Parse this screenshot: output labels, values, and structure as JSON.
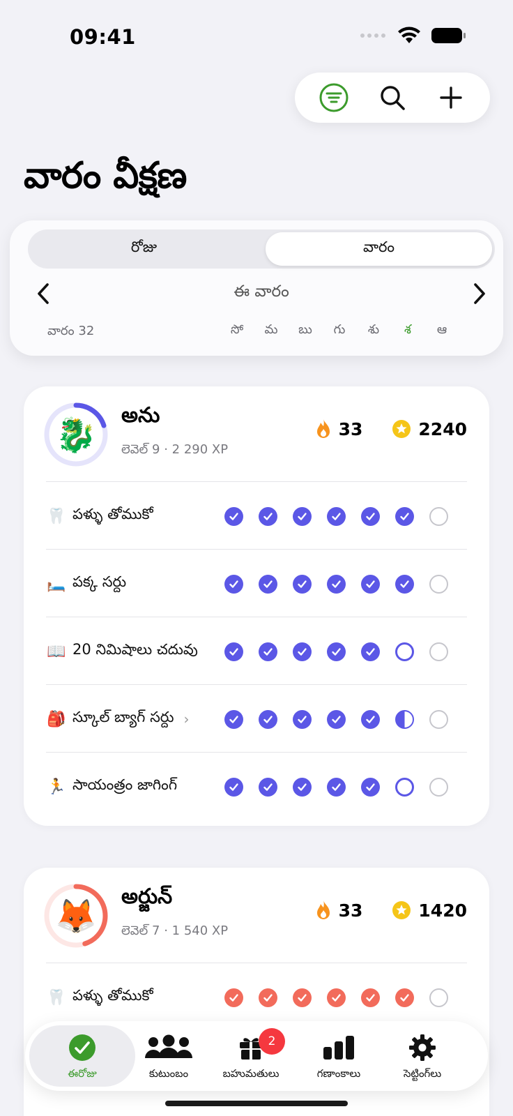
{
  "status": {
    "time": "09:41"
  },
  "title": "వారం వీక్షణ",
  "segment": {
    "day": "రోజు",
    "week": "వారం",
    "selected": "week"
  },
  "week_nav": {
    "label": "ఈ వారం",
    "week_number": "వారం 32"
  },
  "days": [
    "సో",
    "మ",
    "బు",
    "గు",
    "శు",
    "శ",
    "ఆ"
  ],
  "today_index": 5,
  "colors": {
    "accent_green": "#3c9b2c",
    "anu": "#5b57e6",
    "arjun": "#f26b5b",
    "flame": "#f7931e",
    "star": "#f5c518",
    "badge": "#f5383f"
  },
  "members": [
    {
      "name": "అను",
      "level": "లెవెల్ 9 · 2 290 XP",
      "avatar_icon": "dragon-emoji",
      "avatar_glyph": "🐉",
      "level_progress": 0.2,
      "streak": "33",
      "points": "2240",
      "color": "#5b57e6",
      "tasks": [
        {
          "icon": "tooth-icon",
          "glyph": "🦷",
          "label": "పళ్ళు తోముకో",
          "chevron": false,
          "states": [
            "done",
            "done",
            "done",
            "done",
            "done",
            "done",
            "empty"
          ]
        },
        {
          "icon": "bed-icon",
          "glyph": "🛏️",
          "label": "పక్క సర్దు",
          "chevron": false,
          "states": [
            "done",
            "done",
            "done",
            "done",
            "done",
            "done",
            "empty"
          ]
        },
        {
          "icon": "book-icon",
          "glyph": "📖",
          "label": "20 నిమిషాలు చదువు",
          "chevron": false,
          "states": [
            "done",
            "done",
            "done",
            "done",
            "done",
            "open",
            "empty"
          ]
        },
        {
          "icon": "backpack-icon",
          "glyph": "🎒",
          "label": "స్కూల్ బ్యాగ్ సర్దు",
          "chevron": true,
          "states": [
            "done",
            "done",
            "done",
            "done",
            "done",
            "half",
            "empty"
          ]
        },
        {
          "icon": "runner-icon",
          "glyph": "🏃",
          "label": "సాయంత్రం జాగింగ్",
          "chevron": false,
          "states": [
            "done",
            "done",
            "done",
            "done",
            "done",
            "open",
            "empty"
          ]
        }
      ]
    },
    {
      "name": "అర్జున్",
      "level": "లెవెల్ 7 · 1 540 XP",
      "avatar_icon": "fox-emoji",
      "avatar_glyph": "🦊",
      "level_progress": 0.45,
      "streak": "33",
      "points": "1420",
      "color": "#f26b5b",
      "tasks": [
        {
          "icon": "tooth-icon",
          "glyph": "🦷",
          "label": "పళ్ళు తోముకో",
          "chevron": false,
          "states": [
            "done",
            "done",
            "done",
            "done",
            "done",
            "done",
            "empty"
          ]
        }
      ]
    }
  ],
  "tabs": [
    {
      "label": "ఈరోజు",
      "icon": "check-circle-icon",
      "active": true
    },
    {
      "label": "కుటుంబం",
      "icon": "people-icon",
      "active": false
    },
    {
      "label": "బహుమతులు",
      "icon": "gift-icon",
      "active": false,
      "badge": "2"
    },
    {
      "label": "గణాంకాలు",
      "icon": "bar-chart-icon",
      "active": false
    },
    {
      "label": "సెట్టింగ్‌లు",
      "icon": "gear-icon",
      "active": false
    }
  ]
}
